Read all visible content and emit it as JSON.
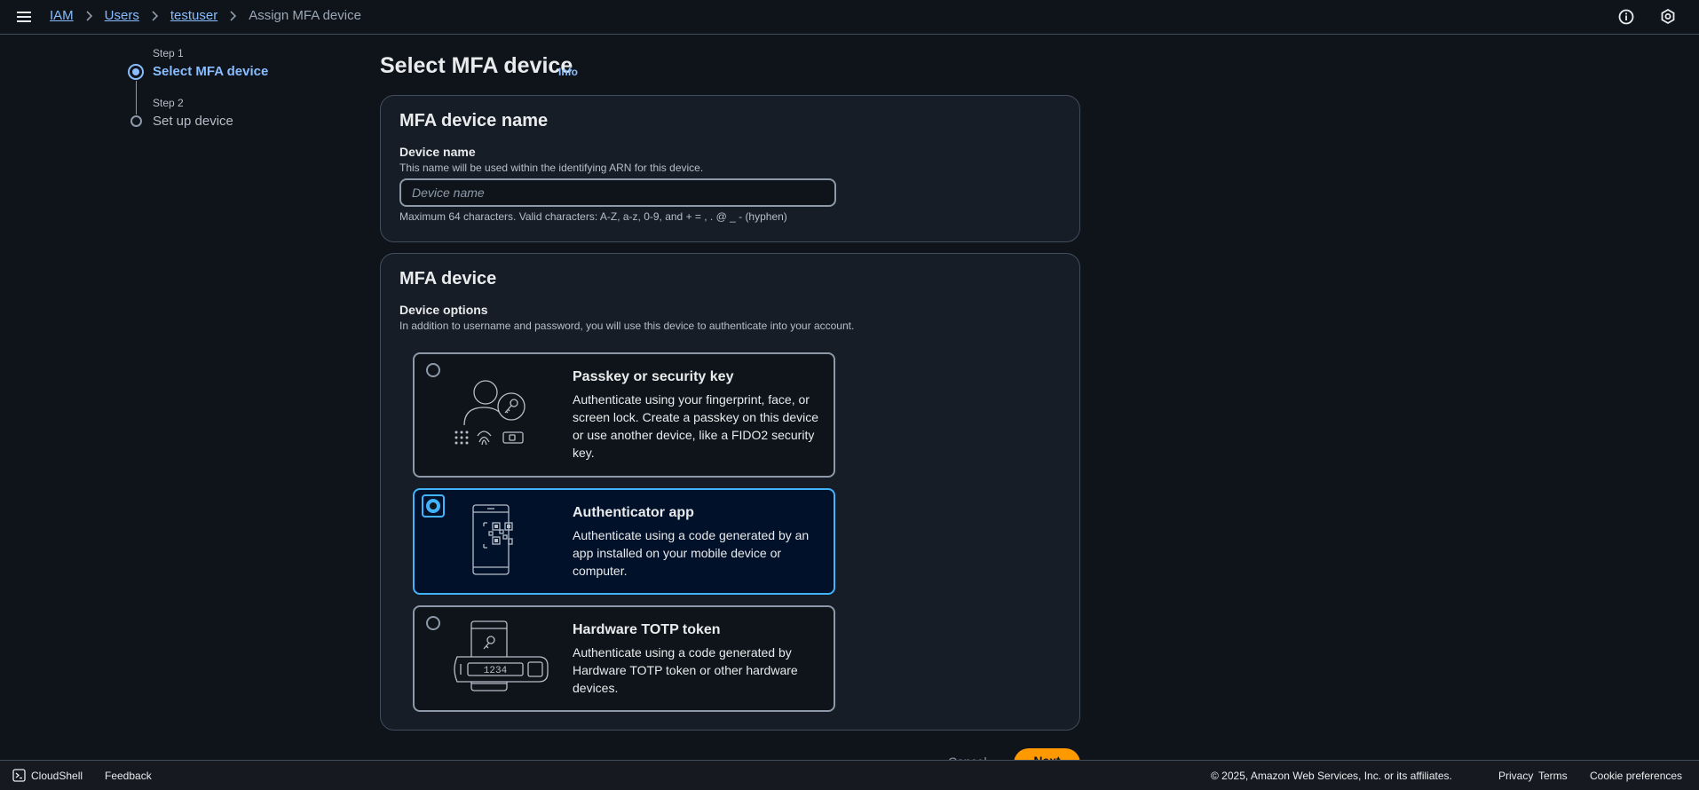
{
  "breadcrumb": {
    "items": [
      {
        "label": "IAM"
      },
      {
        "label": "Users"
      },
      {
        "label": "testuser"
      }
    ],
    "current": "Assign MFA device"
  },
  "steps": [
    {
      "step": "Step 1",
      "title": "Select MFA device",
      "state": "current"
    },
    {
      "step": "Step 2",
      "title": "Set up device",
      "state": "pending"
    }
  ],
  "page": {
    "title": "Select MFA device",
    "info_link": "Info"
  },
  "device_name_section": {
    "heading": "MFA device name",
    "label": "Device name",
    "description": "This name will be used within the identifying ARN for this device.",
    "placeholder": "Device name",
    "value": "",
    "constraint": "Maximum 64 characters. Valid characters: A-Z, a-z, 0-9, and + = , . @ _ - (hyphen)"
  },
  "device_section": {
    "heading": "MFA device",
    "label": "Device options",
    "description": "In addition to username and password, you will use this device to authenticate into your account.",
    "options": [
      {
        "title": "Passkey or security key",
        "description": "Authenticate using your fingerprint, face, or screen lock. Create a passkey on this device or use another device, like a FIDO2 security key.",
        "icon": "passkey-illustration",
        "selected": false
      },
      {
        "title": "Authenticator app",
        "description": "Authenticate using a code generated by an app installed on your mobile device or computer.",
        "icon": "authenticator-app-illustration",
        "selected": true
      },
      {
        "title": "Hardware TOTP token",
        "description": "Authenticate using a code generated by Hardware TOTP token or other hardware devices.",
        "icon": "hardware-token-illustration",
        "token_display": "1234",
        "selected": false
      }
    ]
  },
  "actions": {
    "cancel": "Cancel",
    "next": "Next"
  },
  "footer": {
    "cloudshell": "CloudShell",
    "feedback": "Feedback",
    "copyright": "© 2025, Amazon Web Services, Inc. or its affiliates.",
    "privacy": "Privacy",
    "terms": "Terms",
    "cookies": "Cookie preferences"
  },
  "colors": {
    "background": "#0f141a",
    "container": "#161d26",
    "link": "#89bdff",
    "selected_border": "#42b4ff",
    "primary_button": "#ff9900"
  }
}
